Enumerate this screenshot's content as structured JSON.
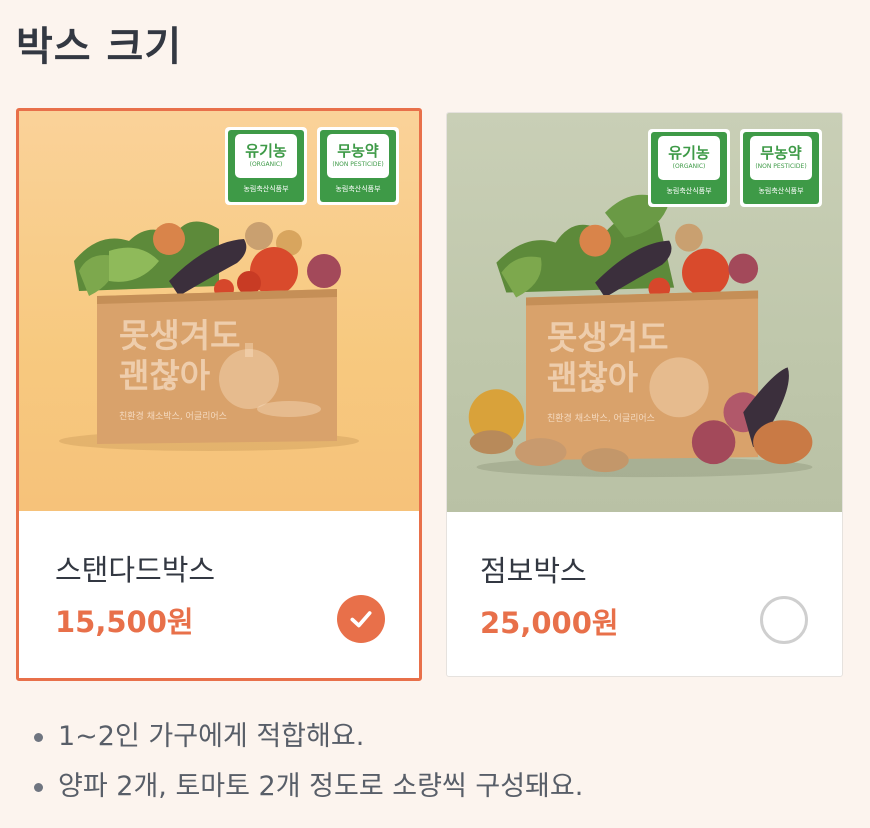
{
  "section": {
    "title": "박스 크기"
  },
  "cards": [
    {
      "name": "스탠다드박스",
      "price": "15,500원",
      "selected": true,
      "badges": [
        {
          "main": "유기농",
          "sub": "(ORGANIC)",
          "footer": "농림축산식품부"
        },
        {
          "main": "무농약",
          "sub": "(NON PESTICIDE)",
          "footer": "농림축산식품부"
        }
      ],
      "box_print": {
        "line1": "못생겨도",
        "line2": "괜찮아",
        "small": "친환경 채소박스, 어글리어스"
      }
    },
    {
      "name": "점보박스",
      "price": "25,000원",
      "selected": false,
      "badges": [
        {
          "main": "유기농",
          "sub": "(ORGANIC)",
          "footer": "농림축산식품부"
        },
        {
          "main": "무농약",
          "sub": "(NON PESTICIDE)",
          "footer": "농림축산식품부"
        }
      ],
      "box_print": {
        "line1": "못생겨도",
        "line2": "괜찮아",
        "small": "친환경 채소박스, 어글리어스"
      }
    }
  ],
  "notes": [
    "1~2인 가구에게 적합해요.",
    "양파 2개, 토마토 2개 정도로 소량씩 구성돼요."
  ],
  "colors": {
    "accent": "#e8704a",
    "badge_green": "#3e9a47",
    "background": "#fcf4ee"
  }
}
